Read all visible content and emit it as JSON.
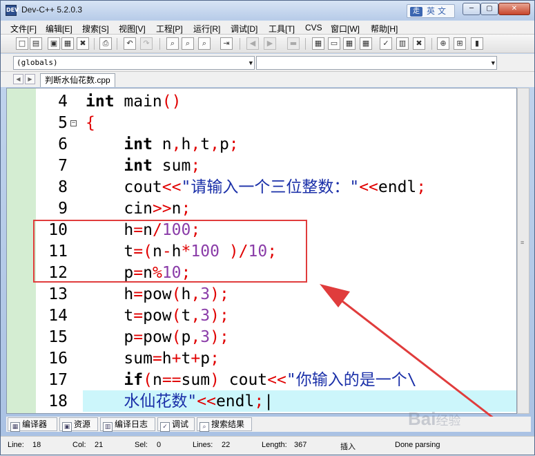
{
  "window": {
    "title": "Dev-C++ 5.2.0.3",
    "app_icon": "DEV"
  },
  "ime": {
    "logo": "走",
    "label": "英文"
  },
  "window_buttons": {
    "minimize": "─",
    "maximize": "▢",
    "close": "✕"
  },
  "menu": [
    "文件[F]",
    "编辑[E]",
    "搜索[S]",
    "视图[V]",
    "工程[P]",
    "运行[R]",
    "调试[D]",
    "工具[T]",
    "CVS",
    "窗口[W]",
    "帮助[H]"
  ],
  "combos": {
    "scope": "(globals)",
    "member": ""
  },
  "editor_tab": "判断水仙花数.cpp",
  "code_lines": [
    {
      "n": "4",
      "t": "int main()"
    },
    {
      "n": "5",
      "t": "{"
    },
    {
      "n": "6",
      "t": "    int n,h,t,p;"
    },
    {
      "n": "7",
      "t": "    int sum;"
    },
    {
      "n": "8",
      "t": "    cout<<\"请输入一个三位整数：\"<<endl;"
    },
    {
      "n": "9",
      "t": "    cin>>n;"
    },
    {
      "n": "10",
      "t": "    h=n/100;"
    },
    {
      "n": "11",
      "t": "    t=(n-h*100 )/10;"
    },
    {
      "n": "12",
      "t": "    p=n%10;"
    },
    {
      "n": "13",
      "t": "    h=pow(h,3);"
    },
    {
      "n": "14",
      "t": "    t=pow(t,3);"
    },
    {
      "n": "15",
      "t": "    p=pow(p,3);"
    },
    {
      "n": "16",
      "t": "    sum=h+t+p;"
    },
    {
      "n": "17",
      "t": "    if(n==sum) cout<<\"你输入的是一个\\"
    },
    {
      "n": "18",
      "t": "    水仙花数\"<<endl;"
    }
  ],
  "bottom_tabs": [
    "编译器",
    "资源",
    "编译日志",
    "调试",
    "搜索结果"
  ],
  "status": {
    "line_label": "Line:",
    "line_value": "18",
    "col_label": "Col:",
    "col_value": "21",
    "sel_label": "Sel:",
    "sel_value": "0",
    "lines_label": "Lines:",
    "lines_value": "22",
    "length_label": "Length:",
    "length_value": "367",
    "mode": "插入",
    "parse_state": "Done parsing"
  },
  "watermark": {
    "text": "Bai",
    "suffix": "经验"
  },
  "colors": {
    "keyword": "#000000",
    "operator": "#e00000",
    "number": "#8a3ca8",
    "string": "#1a2fa8",
    "current_line": "#ccf6fb",
    "gutter": "#d4edd2",
    "annotation": "#e03c3c"
  }
}
